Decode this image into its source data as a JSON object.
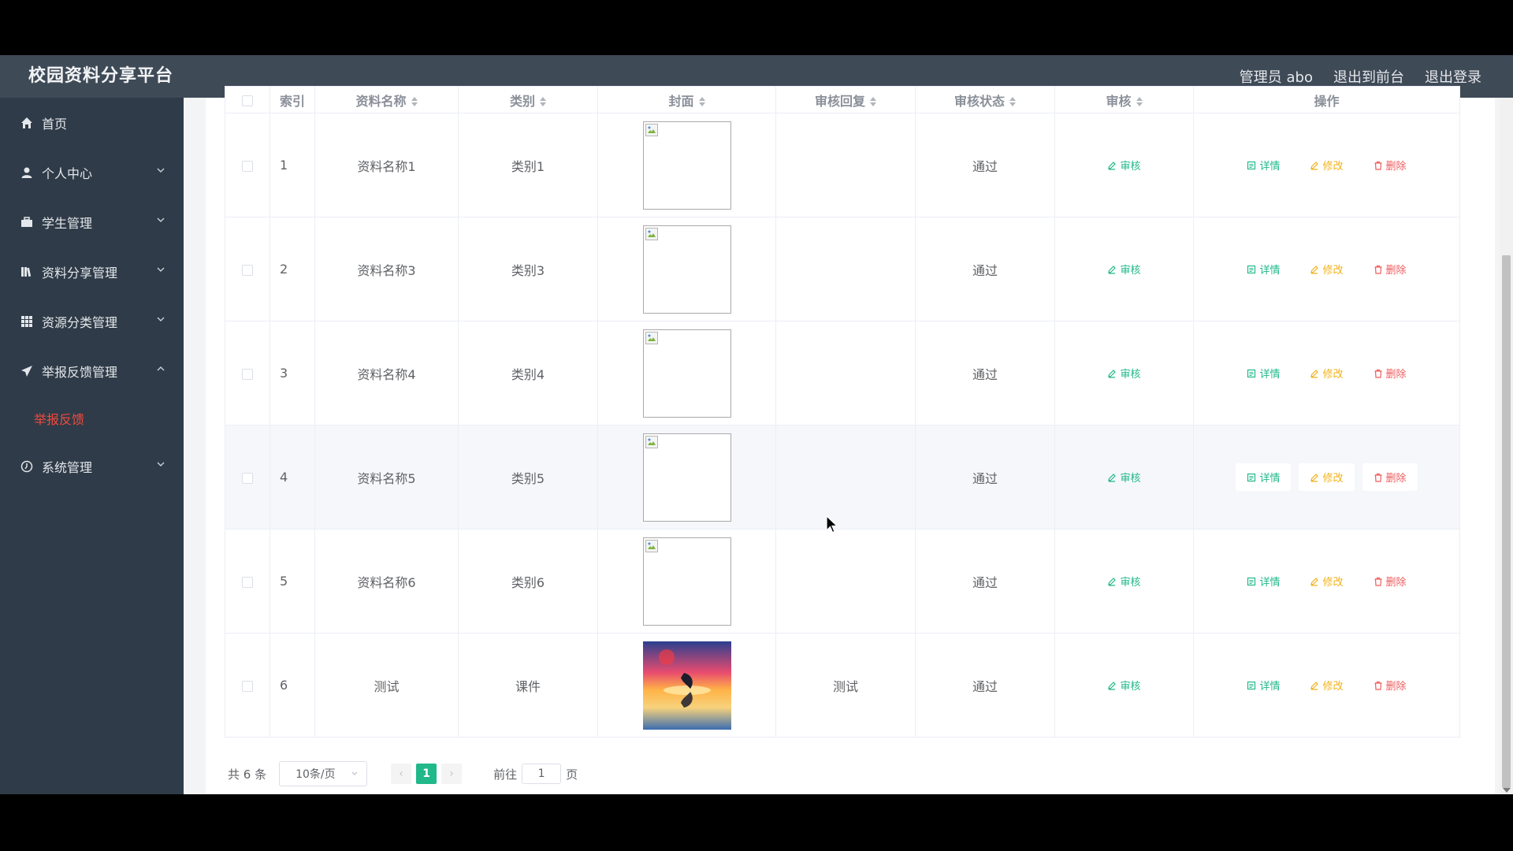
{
  "app": {
    "title": "校园资料分享平台"
  },
  "header": {
    "user": "管理员 abo",
    "to_front": "退出到前台",
    "logout": "退出登录"
  },
  "sidebar": {
    "items": [
      {
        "label": "首页",
        "icon": "home-icon"
      },
      {
        "label": "个人中心",
        "icon": "user-icon",
        "expanded": false
      },
      {
        "label": "学生管理",
        "icon": "briefcase-icon",
        "expanded": false
      },
      {
        "label": "资料分享管理",
        "icon": "books-icon",
        "expanded": false
      },
      {
        "label": "资源分类管理",
        "icon": "grid-icon",
        "expanded": false
      },
      {
        "label": "举报反馈管理",
        "icon": "send-icon",
        "expanded": true
      },
      {
        "label": "系统管理",
        "icon": "clock-icon",
        "expanded": false
      }
    ],
    "active_sub": "举报反馈"
  },
  "table": {
    "columns": [
      "索引",
      "资料名称",
      "类别",
      "封面",
      "审核回复",
      "审核状态",
      "审核",
      "操作"
    ],
    "rows": [
      {
        "index": "1",
        "name": "资料名称1",
        "category": "类别1",
        "reply": "",
        "status": "通过"
      },
      {
        "index": "2",
        "name": "资料名称3",
        "category": "类别3",
        "reply": "",
        "status": "通过"
      },
      {
        "index": "3",
        "name": "资料名称4",
        "category": "类别4",
        "reply": "",
        "status": "通过"
      },
      {
        "index": "4",
        "name": "资料名称5",
        "category": "类别5",
        "reply": "",
        "status": "通过"
      },
      {
        "index": "5",
        "name": "资料名称6",
        "category": "类别6",
        "reply": "",
        "status": "通过"
      },
      {
        "index": "6",
        "name": "测试",
        "category": "课件",
        "reply": "测试",
        "status": "通过"
      }
    ],
    "actions": {
      "review": "审核",
      "detail": "详情",
      "edit": "修改",
      "delete": "删除"
    },
    "hover_row": 3
  },
  "pagination": {
    "total": "共 6 条",
    "page_size": "10条/页",
    "current_page": "1",
    "goto_prefix": "前往",
    "goto_value": "1",
    "goto_suffix": "页"
  },
  "colors": {
    "header_bg": "#3f4a57",
    "sidebar_bg": "#2f3b48",
    "accent_green": "#21b88a",
    "warning_orange": "#f2b21d",
    "danger_red": "#f15c5c",
    "active_menu": "#f04a3e"
  }
}
